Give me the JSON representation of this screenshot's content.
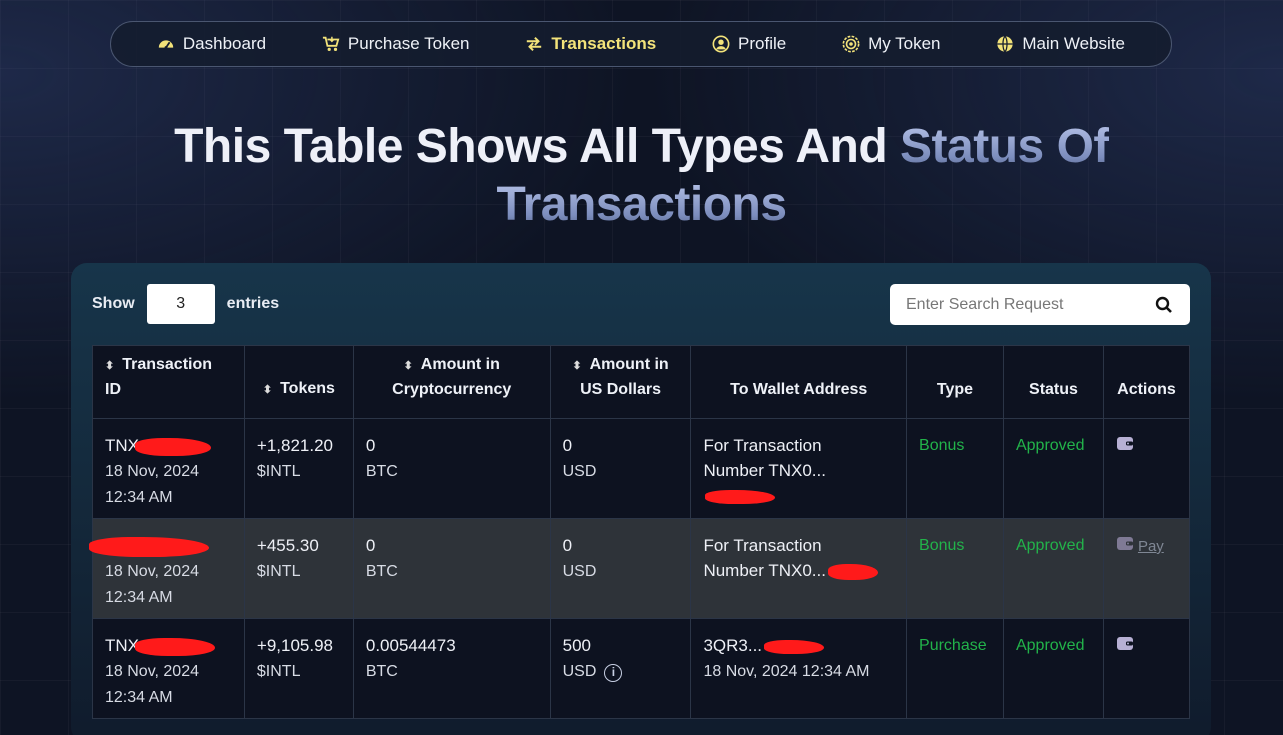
{
  "nav": {
    "items": [
      {
        "label": "Dashboard",
        "icon": "speedometer-icon"
      },
      {
        "label": "Purchase Token",
        "icon": "cart-icon"
      },
      {
        "label": "Transactions",
        "icon": "swap-arrows-icon",
        "active": true
      },
      {
        "label": "Profile",
        "icon": "user-circle-icon"
      },
      {
        "label": "My Token",
        "icon": "coin-icon"
      },
      {
        "label": "Main Website",
        "icon": "globe-icon"
      }
    ]
  },
  "headline": {
    "part1": "This Table Shows All Types And ",
    "part2": "Status Of",
    "part3": "Transactions"
  },
  "entries": {
    "show_label": "Show",
    "value": "3",
    "entries_label": "entries"
  },
  "search": {
    "placeholder": "Enter Search Request"
  },
  "table": {
    "headers": {
      "transaction_id": "Transaction ID",
      "tokens": "Tokens",
      "crypto": "Amount in Cryptocurrency",
      "usd": "Amount in US Dollars",
      "wallet": "To Wallet Address",
      "type": "Type",
      "status": "Status",
      "actions": "Actions"
    },
    "rows": [
      {
        "id_prefix": "TNX",
        "date": "18 Nov, 2024",
        "time": "12:34 AM",
        "tokens": "+1,821.20",
        "token_unit": "$INTL",
        "crypto": "0",
        "crypto_unit": "BTC",
        "usd": "0",
        "usd_unit": "USD",
        "wallet_line1": "For Transaction",
        "wallet_line2": "Number TNX0...",
        "type": "Bonus",
        "status": "Approved"
      },
      {
        "id_prefix": "",
        "date": "18 Nov, 2024",
        "time": "12:34 AM",
        "tokens": "+455.30",
        "token_unit": "$INTL",
        "crypto": "0",
        "crypto_unit": "BTC",
        "usd": "0",
        "usd_unit": "USD",
        "wallet_line1": "For Transaction",
        "wallet_line2": "Number TNX0...",
        "type": "Bonus",
        "status": "Approved",
        "action_label": "Pay"
      },
      {
        "id_prefix": "TNX",
        "date": "18 Nov, 2024",
        "time": "12:34 AM",
        "tokens": "+9,105.98",
        "token_unit": "$INTL",
        "crypto": "0.00544473",
        "crypto_unit": "BTC",
        "usd": "500",
        "usd_unit": "USD",
        "wallet_line1": "3QR3...",
        "wallet_line2": "18 Nov, 2024 12:34 AM",
        "type": "Purchase",
        "status": "Approved"
      }
    ]
  },
  "colors": {
    "active_nav": "#f3e37a",
    "status_green": "#22b34a",
    "redaction": "#ff1a1a"
  }
}
